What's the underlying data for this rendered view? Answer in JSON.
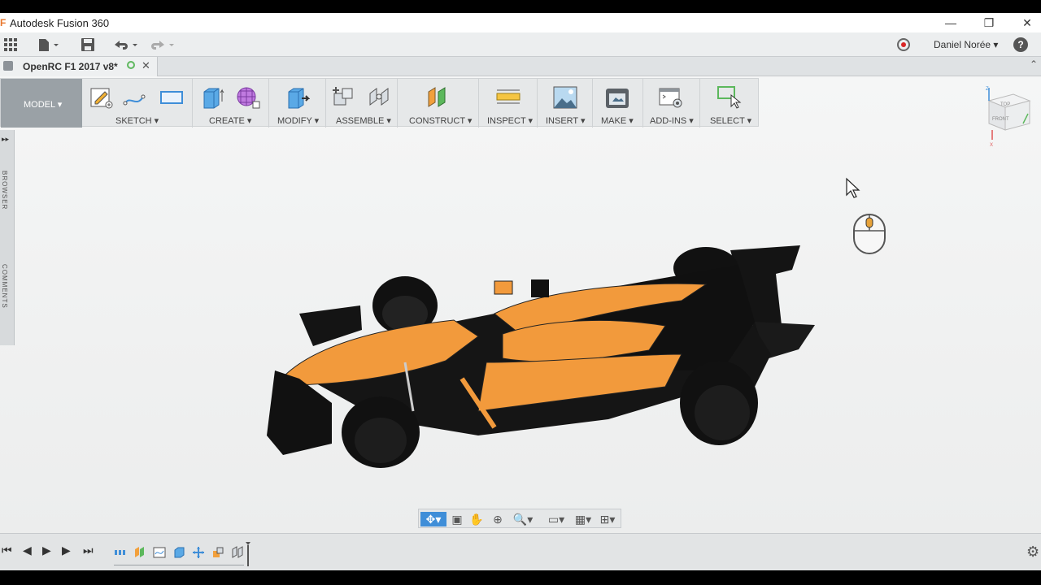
{
  "window": {
    "title": "Autodesk Fusion 360",
    "minimize": "—",
    "restore": "❐",
    "close": "✕"
  },
  "qat": {
    "grid_icon": "grid-icon",
    "file_icon": "file-icon",
    "save_icon": "save-icon",
    "undo_icon": "undo-icon",
    "redo_icon": "redo-icon",
    "user_name": "Daniel Norée ▾",
    "help": "?"
  },
  "document_tab": {
    "label": "OpenRC F1 2017 v8*",
    "close": "✕"
  },
  "ribbon": {
    "workspace": "MODEL ▾",
    "groups": [
      {
        "label": "SKETCH ▾",
        "icons": [
          "sketch-edit-icon",
          "spline-icon",
          "rectangle-icon"
        ]
      },
      {
        "label": "CREATE ▾",
        "icons": [
          "extrude-icon",
          "sculpt-form-icon"
        ]
      },
      {
        "label": "MODIFY ▾",
        "icons": [
          "press-pull-icon"
        ]
      },
      {
        "label": "ASSEMBLE ▾",
        "icons": [
          "new-component-icon",
          "joint-icon"
        ]
      },
      {
        "label": "CONSTRUCT ▾",
        "icons": [
          "offset-plane-icon"
        ]
      },
      {
        "label": "INSPECT ▾",
        "icons": [
          "measure-icon"
        ]
      },
      {
        "label": "INSERT ▾",
        "icons": [
          "insert-image-icon"
        ]
      },
      {
        "label": "MAKE ▾",
        "icons": [
          "3d-print-icon"
        ]
      },
      {
        "label": "ADD-INS ▾",
        "icons": [
          "scripts-icon"
        ]
      },
      {
        "label": "SELECT ▾",
        "icons": [
          "select-icon"
        ]
      }
    ]
  },
  "left_panel": {
    "expand": "▸▸",
    "browser": "BROWSER",
    "comments": "COMMENTS"
  },
  "viewcube": {
    "top": "TOP",
    "front": "FRONT",
    "z": "Z",
    "x": "X"
  },
  "colors": {
    "car_orange": "#f29a3c",
    "car_black": "#141414",
    "accent_blue": "#3f8ed8"
  },
  "navbar": {
    "icons": [
      "orbit-icon",
      "look-at-icon",
      "pan-icon",
      "zoom-icon",
      "zoom-window-icon",
      "display-settings-icon",
      "grid-settings-icon",
      "viewports-icon"
    ]
  },
  "timeline": {
    "first": "⏮",
    "prev": "◀",
    "play": "▶",
    "next": "▶",
    "last": "⏭",
    "gear": "⚙"
  }
}
